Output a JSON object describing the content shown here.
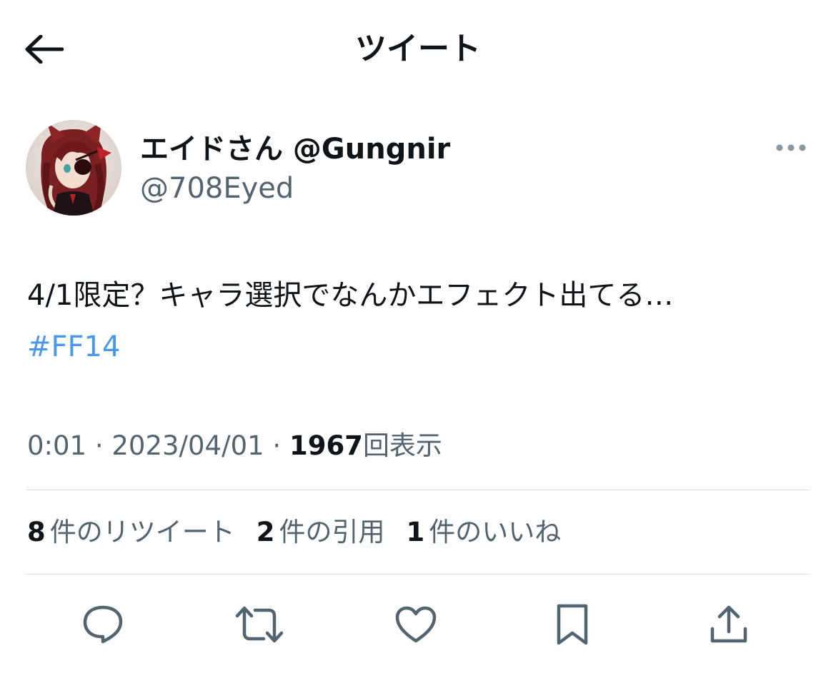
{
  "header": {
    "title": "ツイート",
    "back_icon": "arrow-left-icon"
  },
  "author": {
    "display_name": "エイドさん @Gungnir",
    "handle": "@708Eyed",
    "more_icon": "more-horizontal-icon"
  },
  "tweet": {
    "text": "4/1限定？キャラ選択でなんかエフェクト出てる…",
    "hashtag": "#FF14"
  },
  "meta": {
    "time": "0:01",
    "separator": " · ",
    "date": "2023/04/01",
    "views_count": "1967",
    "views_label": "回表示"
  },
  "stats": [
    {
      "count": "8",
      "label": "件のリツイート"
    },
    {
      "count": "2",
      "label": "件の引用"
    },
    {
      "count": "1",
      "label": "件のいいね"
    }
  ],
  "actions": [
    {
      "icon": "reply-icon"
    },
    {
      "icon": "retweet-icon"
    },
    {
      "icon": "like-heart-icon"
    },
    {
      "icon": "bookmark-icon"
    },
    {
      "icon": "share-icon"
    }
  ],
  "colors": {
    "text": "#0f1419",
    "secondary": "#536471",
    "link": "#4a99e9",
    "divider": "#dfe3e6"
  }
}
